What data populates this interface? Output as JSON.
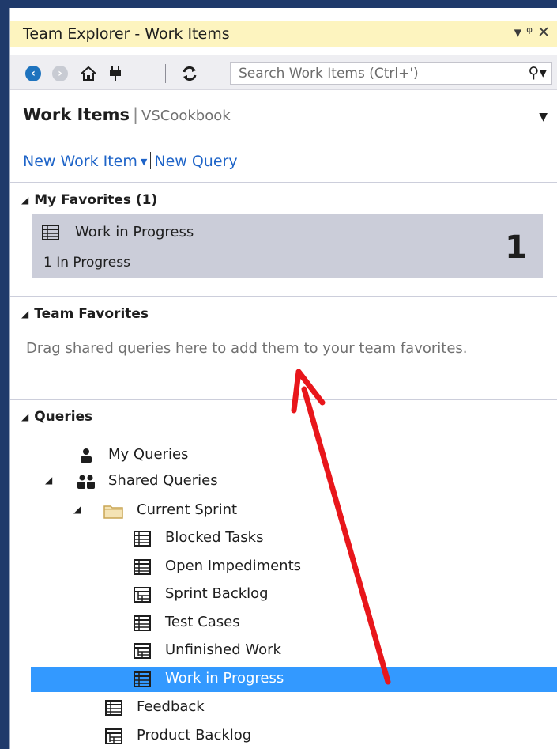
{
  "window": {
    "title": "Team Explorer - Work Items",
    "controls": [
      "dropdown-icon",
      "pin-icon",
      "close-icon"
    ]
  },
  "toolbar": {
    "search_placeholder": "Search Work Items (Ctrl+')"
  },
  "header": {
    "title": "Work Items",
    "project": "VSCookbook"
  },
  "links": {
    "new_work_item": "New Work Item",
    "new_query": "New Query"
  },
  "my_favorites": {
    "title": "My Favorites (1)",
    "card": {
      "name": "Work in Progress",
      "subtitle": "1 In Progress",
      "count": "1"
    }
  },
  "team_favorites": {
    "title": "Team Favorites",
    "hint": "Drag shared queries here to add them to your team favorites."
  },
  "queries": {
    "title": "Queries",
    "my_queries": "My Queries",
    "shared_queries": "Shared Queries",
    "current_sprint": "Current Sprint",
    "sprint_items": [
      {
        "label": "Blocked Tasks",
        "icon": "flat-list-icon"
      },
      {
        "label": "Open Impediments",
        "icon": "flat-list-icon"
      },
      {
        "label": "Sprint Backlog",
        "icon": "tree-list-icon"
      },
      {
        "label": "Test Cases",
        "icon": "flat-list-icon"
      },
      {
        "label": "Unfinished Work",
        "icon": "tree-list-icon"
      },
      {
        "label": "Work in Progress",
        "icon": "flat-list-icon"
      }
    ],
    "shared_items": [
      {
        "label": "Feedback",
        "icon": "flat-list-icon"
      },
      {
        "label": "Product Backlog",
        "icon": "tree-list-icon"
      }
    ]
  },
  "colors": {
    "title_bar": "#fdf4bf",
    "link": "#1e64c8",
    "selection": "#3399ff",
    "favorite_card": "#cbcdd9",
    "annotation_arrow": "#e8161b"
  }
}
